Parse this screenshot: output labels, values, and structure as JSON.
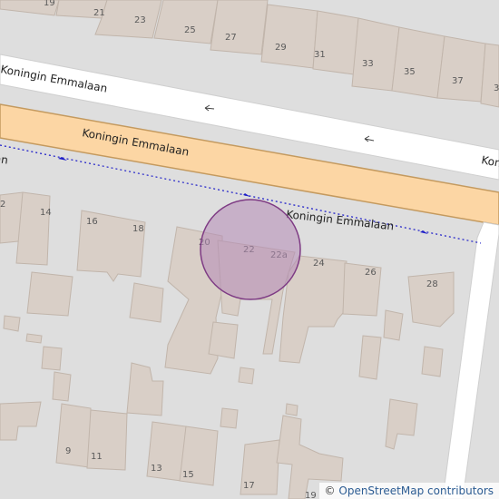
{
  "map": {
    "streets": [
      {
        "name": "Koningin Emmalaan"
      },
      {
        "name": "Koningin Emmalaan"
      },
      {
        "name": "Koningin Emmalaan"
      },
      {
        "name": "Koningin Emmalaan"
      },
      {
        "name": "Koningin Emmalaan"
      }
    ],
    "house_numbers": [
      "19",
      "21",
      "23",
      "25",
      "27",
      "29",
      "31",
      "33",
      "35",
      "37",
      "3",
      "2",
      "14",
      "16",
      "18",
      "20",
      "22",
      "22a",
      "24",
      "26",
      "28",
      "9",
      "11",
      "13",
      "15",
      "17",
      "19"
    ],
    "colors": {
      "background": "#dedede",
      "building": "#d9cfc7",
      "primary_road": "#fcd6a4",
      "primary_road_casing": "#c49a5f",
      "minor_road": "#ffffff",
      "path": "#1c1cc8",
      "marker_fill": "#b48ab7",
      "marker_stroke": "#7e3b84"
    },
    "marker": {
      "type": "location-circle"
    }
  },
  "attribution": {
    "symbol": "©",
    "text": "OpenStreetMap contributors"
  }
}
